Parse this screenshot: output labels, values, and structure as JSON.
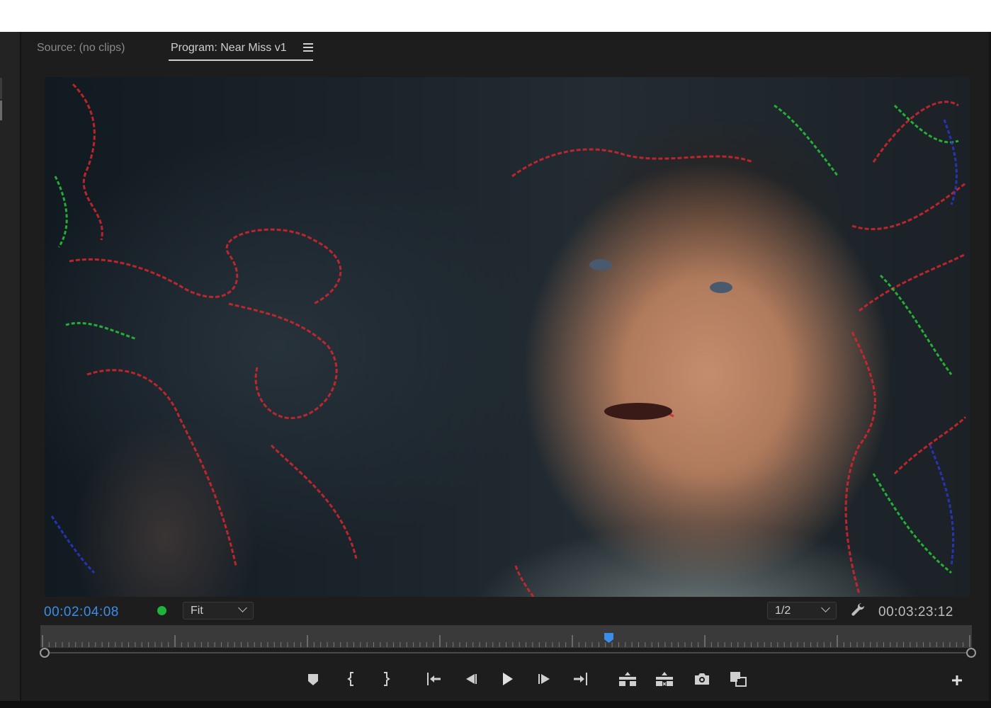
{
  "panel": {
    "tabs": [
      {
        "label": "Source: (no clips)",
        "active": false
      },
      {
        "label": "Program: Near Miss v1",
        "active": true
      }
    ],
    "menu_icon": "hamburger-icon"
  },
  "monitor": {
    "current_timecode": "00:02:04:08",
    "zoom_level": "Fit",
    "resolution": "1/2",
    "duration_timecode": "00:03:23:12",
    "playhead_position_fraction": 0.61,
    "colors": {
      "timecode_current": "#3a8ee8",
      "status_dot": "#1fb33c",
      "playhead": "#3a8ee8"
    }
  },
  "transport": {
    "buttons": [
      {
        "name": "add-marker",
        "icon": "marker-icon"
      },
      {
        "name": "mark-in",
        "icon": "mark-in-icon"
      },
      {
        "name": "mark-out",
        "icon": "mark-out-icon"
      },
      {
        "name": "go-to-in",
        "icon": "go-to-in-icon"
      },
      {
        "name": "step-back",
        "icon": "step-back-icon"
      },
      {
        "name": "play",
        "icon": "play-icon"
      },
      {
        "name": "step-forward",
        "icon": "step-forward-icon"
      },
      {
        "name": "go-to-out",
        "icon": "go-to-out-icon"
      },
      {
        "name": "lift",
        "icon": "lift-icon"
      },
      {
        "name": "extract",
        "icon": "extract-icon"
      },
      {
        "name": "export-frame",
        "icon": "camera-icon"
      },
      {
        "name": "comparison-view",
        "icon": "comparison-view-icon"
      }
    ],
    "add_button_icon": "plus-icon"
  }
}
